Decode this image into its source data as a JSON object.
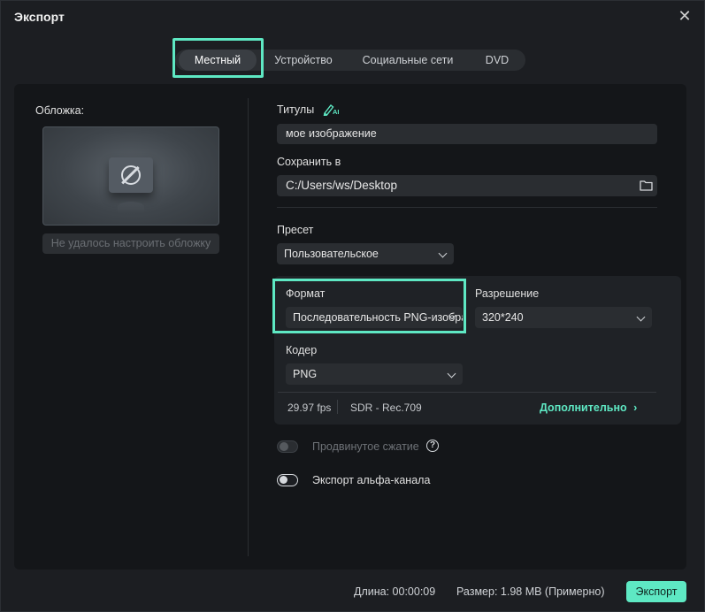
{
  "dialog": {
    "title": "Экспорт"
  },
  "tabs": [
    {
      "label": "Местный",
      "active": true
    },
    {
      "label": "Устройство",
      "active": false
    },
    {
      "label": "Социальные сети",
      "active": false
    },
    {
      "label": "DVD",
      "active": false
    }
  ],
  "cover": {
    "label": "Обложка:",
    "placeholder_icon": "no-image-icon",
    "button_label": "Не удалось настроить обложку"
  },
  "titles": {
    "label": "Титулы",
    "ai_icon": "ai-pen-icon",
    "value": "мое изображение"
  },
  "save_to": {
    "label": "Сохранить в",
    "path": "C:/Users/ws/Desktop",
    "icon": "folder-icon"
  },
  "preset": {
    "label": "Пресет",
    "value": "Пользовательское"
  },
  "format": {
    "label": "Формат",
    "value": "Последовательность PNG-изображений"
  },
  "resolution": {
    "label": "Разрешение",
    "value": "320*240"
  },
  "encoder": {
    "label": "Кодер",
    "value": "PNG"
  },
  "info": {
    "fps": "29.97 fps",
    "color": "SDR - Rec.709",
    "more_label": "Дополнительно"
  },
  "options": {
    "advanced_compression": {
      "label": "Продвинутое сжатие",
      "enabled": false,
      "disabled": true
    },
    "alpha_export": {
      "label": "Экспорт альфа-канала",
      "enabled": false
    }
  },
  "footer": {
    "duration": "Длина: 00:00:09",
    "size": "Размер: 1.98 MB (Примерно)",
    "export_label": "Экспорт"
  },
  "colors": {
    "accent": "#5ee8c3",
    "background": "#1c1e22",
    "panel": "#141619",
    "field": "#2a2d31"
  }
}
